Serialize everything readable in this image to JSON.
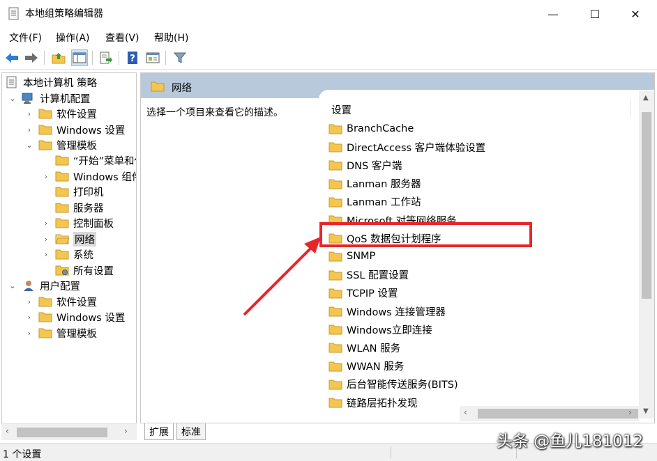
{
  "window": {
    "title": "本地组策略编辑器",
    "controls": {
      "minimize": "—",
      "maximize": "☐",
      "close": "✕"
    }
  },
  "menu": {
    "items": [
      "文件(F)",
      "操作(A)",
      "查看(V)",
      "帮助(H)"
    ]
  },
  "toolbar": {
    "icons": [
      "back-arrow-icon",
      "forward-arrow-icon",
      "up-folder-icon",
      "show-hide-tree-icon",
      "export-list-icon",
      "help-icon",
      "properties-icon",
      "filter-icon"
    ]
  },
  "tree": {
    "items": [
      {
        "label": "本地计算机 策略",
        "icon": "policy-icon",
        "chevron": ""
      },
      {
        "label": "计算机配置",
        "icon": "computer-icon",
        "chevron": "⌄"
      },
      {
        "label": "软件设置",
        "icon": "folder-icon",
        "chevron": "›"
      },
      {
        "label": "Windows 设置",
        "icon": "folder-icon",
        "chevron": "›"
      },
      {
        "label": "管理模板",
        "icon": "folder-icon",
        "chevron": "⌄"
      },
      {
        "label": "“开始”菜单和任",
        "icon": "folder-icon",
        "chevron": ""
      },
      {
        "label": "Windows 组件",
        "icon": "folder-icon",
        "chevron": "›"
      },
      {
        "label": "打印机",
        "icon": "folder-icon",
        "chevron": ""
      },
      {
        "label": "服务器",
        "icon": "folder-icon",
        "chevron": ""
      },
      {
        "label": "控制面板",
        "icon": "folder-icon",
        "chevron": "›"
      },
      {
        "label": "网络",
        "icon": "folder-open-icon",
        "chevron": "›"
      },
      {
        "label": "系统",
        "icon": "folder-icon",
        "chevron": "›"
      },
      {
        "label": "所有设置",
        "icon": "folder-settings-icon",
        "chevron": ""
      },
      {
        "label": "用户配置",
        "icon": "user-icon",
        "chevron": "⌄"
      },
      {
        "label": "软件设置",
        "icon": "folder-icon",
        "chevron": "›"
      },
      {
        "label": "Windows 设置",
        "icon": "folder-icon",
        "chevron": "›"
      },
      {
        "label": "管理模板",
        "icon": "folder-icon",
        "chevron": "›"
      }
    ],
    "scroll_left": "‹",
    "scroll_right": "›"
  },
  "right_pane": {
    "header_title": "网络",
    "description": "选择一个项目来查看它的描述。",
    "column_header": "设置",
    "items": [
      "BranchCache",
      "DirectAccess 客户端体验设置",
      "DNS 客户端",
      "Lanman 服务器",
      "Lanman 工作站",
      "Microsoft 对等网络服务",
      "QoS 数据包计划程序",
      "SNMP",
      "SSL 配置设置",
      "TCPIP 设置",
      "Windows 连接管理器",
      "Windows立即连接",
      "WLAN 服务",
      "WWAN 服务",
      "后台智能传送服务(BITS)",
      "链路层拓扑发现"
    ],
    "vscroll_up": "▲",
    "vscroll_down": "▼",
    "hscroll_left": "‹",
    "hscroll_right": "›"
  },
  "tabs": [
    "扩展",
    "标准"
  ],
  "status": {
    "text": "1 个设置"
  },
  "watermark": "头条 @鱼儿181012",
  "colors": {
    "highlight": "#e8262a",
    "header_bg": "#b9c9dc",
    "folder": "#f3c74f"
  }
}
